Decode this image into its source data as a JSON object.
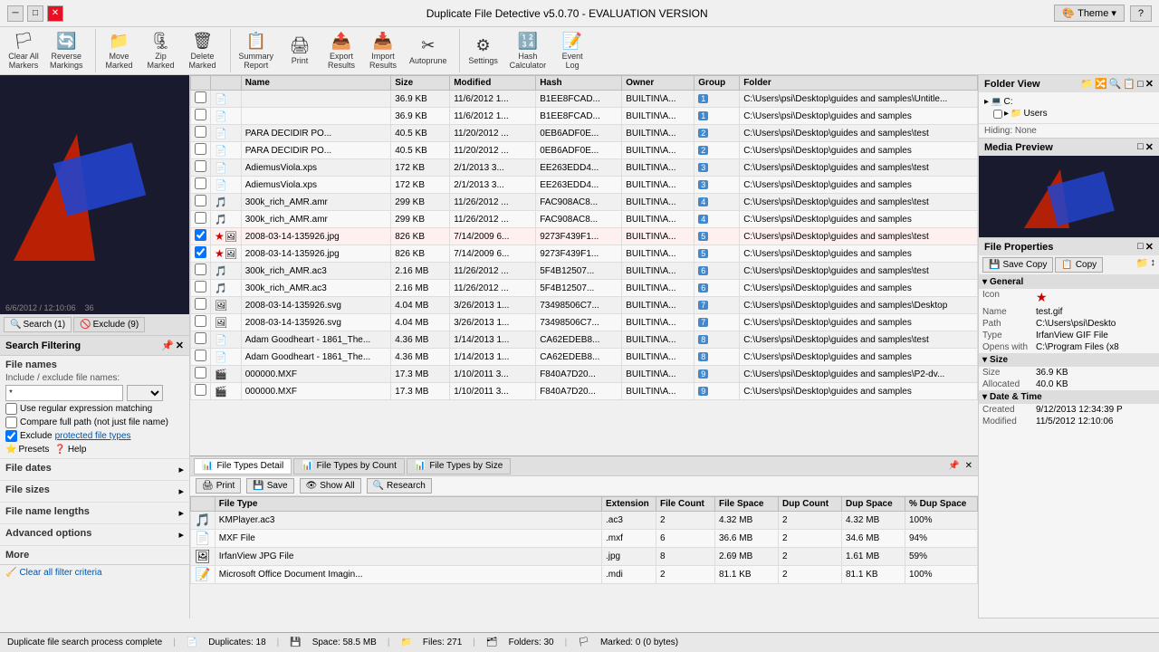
{
  "app": {
    "title": "Duplicate File Detective v5.0.70 - EVALUATION VERSION",
    "theme_label": "Theme"
  },
  "toolbar": {
    "groups": [
      {
        "name": "markers",
        "items": [
          {
            "id": "clear-all",
            "label": "Clear All\nMarkers",
            "icon": "🏳"
          },
          {
            "id": "reverse",
            "label": "Reverse\nMarkings",
            "icon": "🔄"
          }
        ]
      },
      {
        "name": "marked",
        "items": [
          {
            "id": "move-marked",
            "label": "Move\nMarked",
            "icon": "📁"
          },
          {
            "id": "zip-marked",
            "label": "Zip\nMarked",
            "icon": "🗜"
          },
          {
            "id": "delete-marked",
            "label": "Delete\nMarked",
            "icon": "🗑"
          }
        ]
      },
      {
        "name": "report",
        "items": [
          {
            "id": "summary-report",
            "label": "Summary\nReport",
            "icon": "📋"
          },
          {
            "id": "print",
            "label": "Print",
            "icon": "🖨"
          },
          {
            "id": "export-results",
            "label": "Export\nResults",
            "icon": "📤"
          },
          {
            "id": "import-results",
            "label": "Import\nResults",
            "icon": "📥"
          },
          {
            "id": "autoprune",
            "label": "Autoprune",
            "icon": "✂"
          }
        ]
      },
      {
        "name": "tools",
        "items": [
          {
            "id": "settings",
            "label": "Settings",
            "icon": "⚙"
          },
          {
            "id": "hash-calculator",
            "label": "Hash\nCalculator",
            "icon": "🔢"
          },
          {
            "id": "event-log",
            "label": "Event\nLog",
            "icon": "📝"
          }
        ]
      }
    ]
  },
  "left_panel": {
    "search_tabs": [
      {
        "label": "Search (1)",
        "active": true
      },
      {
        "label": "Exclude (9)",
        "active": false
      }
    ],
    "filter_header": "Search Filtering",
    "sections": [
      {
        "title": "File names",
        "content": "include_exclude",
        "label": "Include / exclude file names:",
        "input_value": "*",
        "dropdown": ""
      },
      {
        "title": "File dates",
        "collapsed": true
      },
      {
        "title": "File sizes",
        "collapsed": true
      },
      {
        "title": "File name lengths",
        "collapsed": true
      },
      {
        "title": "Advanced options",
        "collapsed": true
      }
    ],
    "checkboxes": [
      {
        "label": "Use regular expression matching",
        "checked": false
      },
      {
        "label": "Compare full path (not just file name)",
        "checked": false
      },
      {
        "label": "Exclude protected file types",
        "checked": true,
        "link": true
      }
    ],
    "more_label": "More",
    "presets_label": "Presets",
    "help_label": "Help",
    "clear_filter_label": "Clear all filter criteria"
  },
  "results": {
    "columns": [
      "",
      "",
      "Size",
      "Modified",
      "Hash",
      "Owner",
      "Group",
      "Folder"
    ],
    "rows": [
      {
        "check": false,
        "dup": false,
        "name": "",
        "size": "36.9 KB",
        "modified": "11/6/2012 1...",
        "hash": "B1EE8FCAD...",
        "owner": "BUILTIN\\A...",
        "group": "1",
        "folder": "C:\\Users\\psi\\Desktop\\guides and samples\\Untitle...",
        "icon": "📄"
      },
      {
        "check": false,
        "dup": false,
        "name": "",
        "size": "36.9 KB",
        "modified": "11/6/2012 1...",
        "hash": "B1EE8FCAD...",
        "owner": "BUILTIN\\A...",
        "group": "1",
        "folder": "C:\\Users\\psi\\Desktop\\guides and samples",
        "icon": "📄"
      },
      {
        "check": false,
        "dup": false,
        "name": "PARA DECIDIR PO...",
        "size": "40.5 KB",
        "modified": "11/20/2012 ...",
        "hash": "0EB6ADF0E...",
        "owner": "BUILTIN\\A...",
        "group": "2",
        "folder": "C:\\Users\\psi\\Desktop\\guides and samples\\test",
        "icon": "📄"
      },
      {
        "check": false,
        "dup": false,
        "name": "PARA DECIDIR PO...",
        "size": "40.5 KB",
        "modified": "11/20/2012 ...",
        "hash": "0EB6ADF0E...",
        "owner": "BUILTIN\\A...",
        "group": "2",
        "folder": "C:\\Users\\psi\\Desktop\\guides and samples",
        "icon": "📄"
      },
      {
        "check": false,
        "dup": false,
        "name": "AdiemusViola.xps",
        "size": "172 KB",
        "modified": "2/1/2013 3...",
        "hash": "EE263EDD4...",
        "owner": "BUILTIN\\A...",
        "group": "3",
        "folder": "C:\\Users\\psi\\Desktop\\guides and samples\\test",
        "icon": "📄"
      },
      {
        "check": false,
        "dup": false,
        "name": "AdiemusViola.xps",
        "size": "172 KB",
        "modified": "2/1/2013 3...",
        "hash": "EE263EDD4...",
        "owner": "BUILTIN\\A...",
        "group": "3",
        "folder": "C:\\Users\\psi\\Desktop\\guides and samples",
        "icon": "📄"
      },
      {
        "check": false,
        "dup": false,
        "name": "300k_rich_AMR.amr",
        "size": "299 KB",
        "modified": "11/26/2012 ...",
        "hash": "FAC908AC8...",
        "owner": "BUILTIN\\A...",
        "group": "4",
        "folder": "C:\\Users\\psi\\Desktop\\guides and samples\\test",
        "icon": "🎵"
      },
      {
        "check": false,
        "dup": false,
        "name": "300k_rich_AMR.amr",
        "size": "299 KB",
        "modified": "11/26/2012 ...",
        "hash": "FAC908AC8...",
        "owner": "BUILTIN\\A...",
        "group": "4",
        "folder": "C:\\Users\\psi\\Desktop\\guides and samples",
        "icon": "🎵"
      },
      {
        "check": true,
        "dup": true,
        "name": "2008-03-14-135926.jpg",
        "size": "826 KB",
        "modified": "7/14/2009 6...",
        "hash": "9273F439F1...",
        "owner": "BUILTIN\\A...",
        "group": "5",
        "folder": "C:\\Users\\psi\\Desktop\\guides and samples\\test",
        "icon": "🖼"
      },
      {
        "check": true,
        "dup": true,
        "name": "2008-03-14-135926.jpg",
        "size": "826 KB",
        "modified": "7/14/2009 6...",
        "hash": "9273F439F1...",
        "owner": "BUILTIN\\A...",
        "group": "5",
        "folder": "C:\\Users\\psi\\Desktop\\guides and samples",
        "icon": "🖼"
      },
      {
        "check": false,
        "dup": false,
        "name": "300k_rich_AMR.ac3",
        "size": "2.16 MB",
        "modified": "11/26/2012 ...",
        "hash": "5F4B12507...",
        "owner": "BUILTIN\\A...",
        "group": "6",
        "folder": "C:\\Users\\psi\\Desktop\\guides and samples\\test",
        "icon": "🎵"
      },
      {
        "check": false,
        "dup": false,
        "name": "300k_rich_AMR.ac3",
        "size": "2.16 MB",
        "modified": "11/26/2012 ...",
        "hash": "5F4B12507...",
        "owner": "BUILTIN\\A...",
        "group": "6",
        "folder": "C:\\Users\\psi\\Desktop\\guides and samples",
        "icon": "🎵"
      },
      {
        "check": false,
        "dup": false,
        "name": "2008-03-14-135926.svg",
        "size": "4.04 MB",
        "modified": "3/26/2013 1...",
        "hash": "73498506C7...",
        "owner": "BUILTIN\\A...",
        "group": "7",
        "folder": "C:\\Users\\psi\\Desktop\\guides and samples\\Desktop",
        "icon": "🖼"
      },
      {
        "check": false,
        "dup": false,
        "name": "2008-03-14-135926.svg",
        "size": "4.04 MB",
        "modified": "3/26/2013 1...",
        "hash": "73498506C7...",
        "owner": "BUILTIN\\A...",
        "group": "7",
        "folder": "C:\\Users\\psi\\Desktop\\guides and samples",
        "icon": "🖼"
      },
      {
        "check": false,
        "dup": false,
        "name": "Adam Goodheart - 1861_The...",
        "size": "4.36 MB",
        "modified": "1/14/2013 1...",
        "hash": "CA62EDEB8...",
        "owner": "BUILTIN\\A...",
        "group": "8",
        "folder": "C:\\Users\\psi\\Desktop\\guides and samples\\test",
        "icon": "📄"
      },
      {
        "check": false,
        "dup": false,
        "name": "Adam Goodheart - 1861_The...",
        "size": "4.36 MB",
        "modified": "1/14/2013 1...",
        "hash": "CA62EDEB8...",
        "owner": "BUILTIN\\A...",
        "group": "8",
        "folder": "C:\\Users\\psi\\Desktop\\guides and samples",
        "icon": "📄"
      },
      {
        "check": false,
        "dup": false,
        "name": "000000.MXF",
        "size": "17.3 MB",
        "modified": "1/10/2011 3...",
        "hash": "F840A7D20...",
        "owner": "BUILTIN\\A...",
        "group": "9",
        "folder": "C:\\Users\\psi\\Desktop\\guides and samples\\P2-dv...",
        "icon": "🎬"
      },
      {
        "check": false,
        "dup": false,
        "name": "000000.MXF",
        "size": "17.3 MB",
        "modified": "1/10/2011 3...",
        "hash": "F840A7D20...",
        "owner": "BUILTIN\\A...",
        "group": "9",
        "folder": "C:\\Users\\psi\\Desktop\\guides and samples",
        "icon": "🎬"
      }
    ]
  },
  "bottom_panel": {
    "tabs": [
      {
        "label": "File Types Detail",
        "icon": "📊",
        "active": true
      },
      {
        "label": "File Types by Count",
        "icon": "📊",
        "active": false
      },
      {
        "label": "File Types by Size",
        "icon": "📊",
        "active": false
      }
    ],
    "toolbar": [
      {
        "id": "print",
        "label": "Print",
        "icon": "🖨"
      },
      {
        "id": "save",
        "label": "Save",
        "icon": "💾"
      },
      {
        "id": "show-all",
        "label": "Show All",
        "icon": "👁"
      },
      {
        "id": "research",
        "label": "Research",
        "icon": "🔍"
      }
    ],
    "columns": [
      "",
      "File Type",
      "Extension",
      "File Count",
      "File Space",
      "Dup Count",
      "Dup Space",
      "% Dup Space"
    ],
    "rows": [
      {
        "icon": "🎵",
        "type": "KMPlayer.ac3",
        "ext": ".ac3",
        "count": "2",
        "space": "4.32 MB",
        "dup_count": "2",
        "dup_space": "4.32 MB",
        "pct": "100%"
      },
      {
        "icon": "📄",
        "type": "MXF File",
        "ext": ".mxf",
        "count": "6",
        "space": "36.6 MB",
        "dup_count": "2",
        "dup_space": "34.6 MB",
        "pct": "94%"
      },
      {
        "icon": "🖼",
        "type": "IrfanView JPG File",
        "ext": ".jpg",
        "count": "8",
        "space": "2.69 MB",
        "dup_count": "2",
        "dup_space": "1.61 MB",
        "pct": "59%"
      },
      {
        "icon": "📝",
        "type": "Microsoft Office Document Imagin...",
        "ext": ".mdi",
        "count": "2",
        "space": "81.1 KB",
        "dup_count": "2",
        "dup_space": "81.1 KB",
        "pct": "100%"
      }
    ]
  },
  "right_panel": {
    "folder_view": {
      "title": "Folder View",
      "tree": [
        {
          "label": "C:",
          "level": 0,
          "expanded": true
        },
        {
          "label": "Users",
          "level": 1,
          "expanded": true
        }
      ]
    },
    "hiding": "Hiding: None",
    "media_preview": {
      "title": "Media Preview"
    },
    "file_properties": {
      "title": "File Properties",
      "save_label": "Save Copy",
      "copy_label": "Copy",
      "general_title": "General",
      "props": [
        {
          "label": "Icon",
          "value": "★",
          "is_icon": true
        },
        {
          "label": "Name",
          "value": "test.gif"
        },
        {
          "label": "Path",
          "value": "C:\\Users\\psi\\Deskto"
        },
        {
          "label": "Type",
          "value": "IrfanView GIF File"
        },
        {
          "label": "Opens with",
          "value": "C:\\Program Files (x8"
        }
      ],
      "size_title": "Size",
      "size_props": [
        {
          "label": "Size",
          "value": "36.9 KB"
        },
        {
          "label": "Allocated",
          "value": "40.0 KB"
        }
      ],
      "date_title": "Date & Time",
      "date_props": [
        {
          "label": "Created",
          "value": "9/12/2013 12:34:39 P"
        },
        {
          "label": "Modified",
          "value": "11/5/2012 12:10:06"
        }
      ]
    }
  },
  "status_bar": {
    "message": "Duplicate file search process complete",
    "duplicates": "Duplicates: 18",
    "space": "Space: 58.5 MB",
    "files": "Files: 271",
    "folders": "Folders: 30",
    "marked": "Marked: 0 (0 bytes)"
  }
}
